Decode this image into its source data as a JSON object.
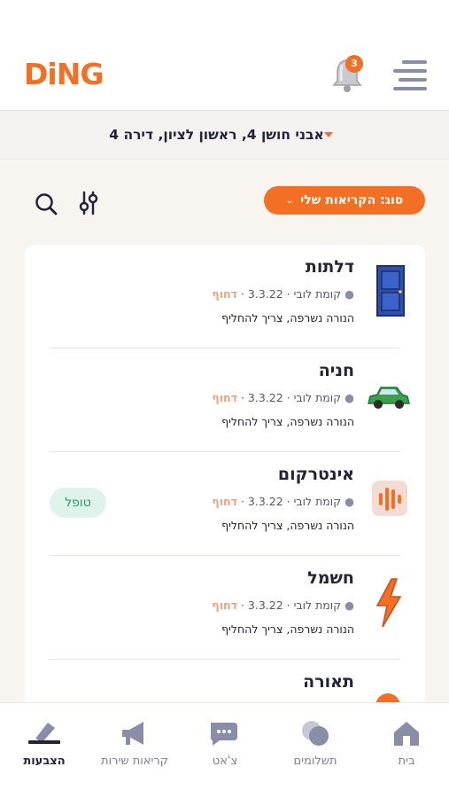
{
  "header": {
    "logo": "DiNG",
    "notifications_count": "3",
    "icons": {
      "bell": "bell-icon",
      "menu": "hamburger-menu-icon"
    }
  },
  "address": {
    "text": "אבני חושן 4, ראשון לציון, דירה 4",
    "caret_icon": "caret-down-icon"
  },
  "filters": {
    "type_label": "סוג: הקריאות שלי",
    "chevron_icon": "chevron-down-icon",
    "search_icon": "search-icon",
    "sliders_icon": "sliders-icon"
  },
  "tickets": [
    {
      "title": "דלתות",
      "location": "קומת לובי",
      "date": "3.3.22",
      "priority": "דחוף",
      "description": "הנורה נשרפה, צריך להחליף",
      "icon": "door-icon",
      "badge": ""
    },
    {
      "title": "חניה",
      "location": "קומת לובי",
      "date": "3.3.22",
      "priority": "דחוף",
      "description": "הנורה נשרפה, צריך להחליף",
      "icon": "car-icon",
      "badge": ""
    },
    {
      "title": "אינטרקום",
      "location": "קומת לובי",
      "date": "3.3.22",
      "priority": "דחוף",
      "description": "הנורה נשרפה, צריך להחליף",
      "icon": "intercom-icon",
      "badge": "טופל"
    },
    {
      "title": "חשמל",
      "location": "קומת לובי",
      "date": "3.3.22",
      "priority": "דחוף",
      "description": "הנורה נשרפה, צריך להחליף",
      "icon": "lightning-icon",
      "badge": ""
    },
    {
      "title": "תאורה",
      "location": "",
      "date": "",
      "priority": "",
      "description": "",
      "icon": "light-icon",
      "badge": ""
    }
  ],
  "nav": {
    "home": "בית",
    "payments": "תשלומים",
    "chat": "צ'אט",
    "service_calls": "קריאות שירות",
    "votes": "הצבעות",
    "active": "votes"
  },
  "colors": {
    "brand": "#f36f24",
    "dark": "#23223b",
    "success_bg": "#dff3ea",
    "success_text": "#2a9b62"
  }
}
